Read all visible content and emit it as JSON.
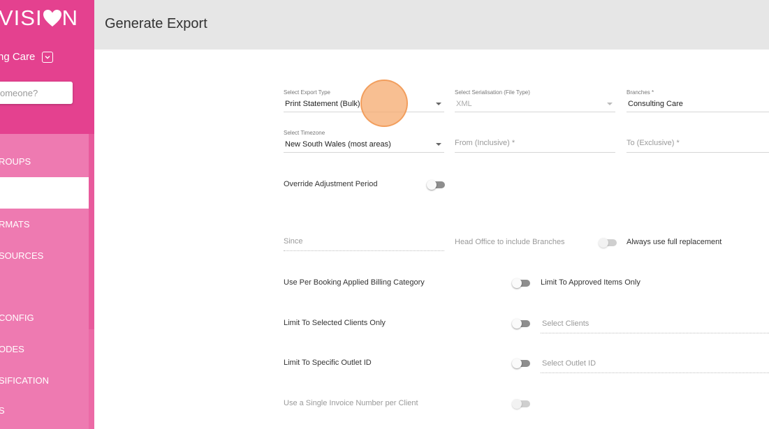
{
  "sidebar": {
    "logo": "VISI",
    "logo_end": "N",
    "organisation": "ng Care",
    "search_placeholder": "omeone?",
    "items": [
      {
        "label": "ROUPS"
      },
      {
        "label": ""
      },
      {
        "label": "RMATS"
      },
      {
        "label": "SOURCES"
      },
      {
        "label": ""
      },
      {
        "label": "CONFIG"
      },
      {
        "label": "ODES"
      },
      {
        "label": "SIFICATION"
      },
      {
        "label": "S"
      }
    ]
  },
  "header": {
    "title": "Generate Export"
  },
  "form": {
    "export_type": {
      "label": "Select Export Type",
      "value": "Print Statement (Bulk)"
    },
    "serialisation": {
      "label": "Select Serialisation (File Type)",
      "value": "XML"
    },
    "branches": {
      "label": "Branches *",
      "value": "Consulting Care"
    },
    "timezone": {
      "label": "Select Timezone",
      "value": "New South Wales (most areas)"
    },
    "from": {
      "placeholder": "From (Inclusive) *"
    },
    "to": {
      "placeholder": "To (Exclusive) *"
    },
    "override_adjustment": {
      "label": "Override Adjustment Period",
      "on": false
    },
    "since": {
      "placeholder": "Since"
    },
    "head_office": {
      "label": "Head Office to include Branches",
      "on": false
    },
    "full_replacement": {
      "label": "Always use full replacement"
    },
    "per_booking": {
      "label": "Use Per Booking Applied Billing Category",
      "on": false
    },
    "approved_only": {
      "label": "Limit To Approved Items Only"
    },
    "selected_clients": {
      "label": "Limit To Selected Clients Only",
      "on": false
    },
    "select_clients": {
      "placeholder": "Select Clients"
    },
    "outlet_id": {
      "label": "Limit To Specific Outlet ID",
      "on": false
    },
    "select_outlet": {
      "placeholder": "Select Outlet ID"
    },
    "single_invoice": {
      "label": "Use a Single Invoice Number per Client",
      "on": false
    }
  },
  "colors": {
    "sidebar_top": "#e4418f",
    "sidebar_nav": "#ee7ab1",
    "header_bg": "#e6e6e6"
  }
}
